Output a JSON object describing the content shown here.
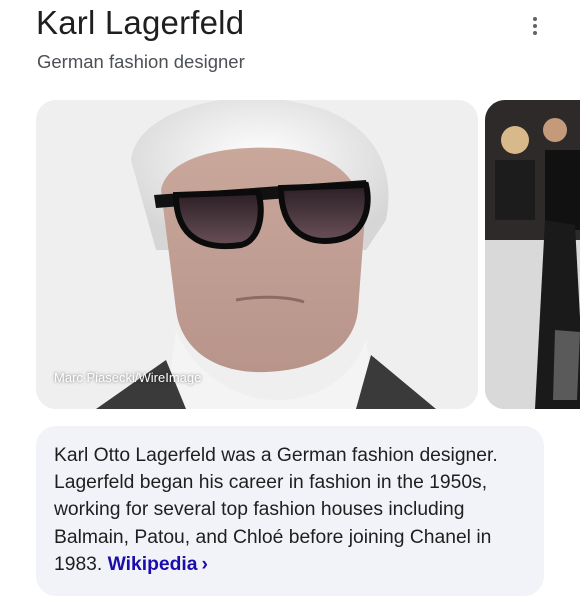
{
  "entity": {
    "title": "Karl Lagerfeld",
    "subtitle": "German fashion designer"
  },
  "images": {
    "credit": "Marc Piasecki/WireImage"
  },
  "description": {
    "text": "Karl Otto Lagerfeld was a German fashion designer. Lagerfeld began his career in fashion in the 1950s, working for several top fashion houses including Balmain, Patou, and Chloé before joining Chanel in 1983. ",
    "source_link": "Wikipedia",
    "source_chevron": "›"
  },
  "icons": {
    "more": "more-vert-icon"
  },
  "colors": {
    "link": "#1a0dab",
    "card_bg": "#f1f3f8",
    "title": "#1f1f1f",
    "subtitle": "#4d5156"
  }
}
